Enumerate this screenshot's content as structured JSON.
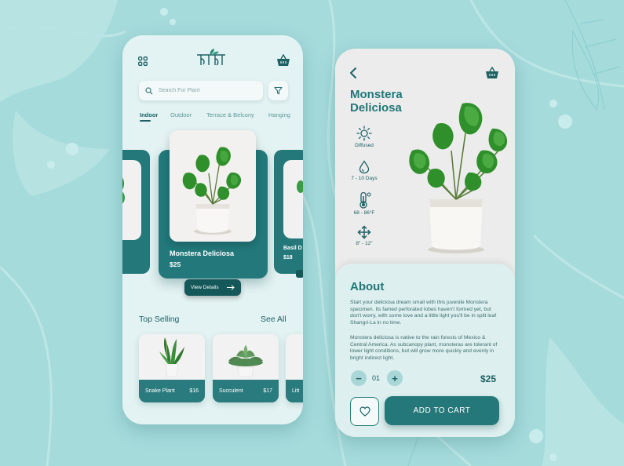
{
  "colors": {
    "background": "#a6dbdc",
    "accent": "#22777a",
    "dark_accent": "#14585a",
    "panel": "#e3f2f2"
  },
  "left_screen": {
    "menu_icon": "grid-icon",
    "logo_text": "ীটপা",
    "basket_icon": "basket-icon",
    "search": {
      "placeholder": "Search For Plant",
      "value": ""
    },
    "filter_icon": "filter-icon",
    "tabs": [
      {
        "label": "Indoor",
        "active": true
      },
      {
        "label": "Outdoor",
        "active": false
      },
      {
        "label": "Terrace & Belcony",
        "active": false
      },
      {
        "label": "Hanging",
        "active": false
      }
    ],
    "featured": {
      "name": "Monstera Deliciosa",
      "price": "$25",
      "button_label": "View Details",
      "button_icon": "arrow-right-icon"
    },
    "next_card": {
      "name": "Basil D",
      "price": "$18"
    },
    "top_selling": {
      "title": "Top Selling",
      "see_all": "See All",
      "items": [
        {
          "name": "Snake Plant",
          "price": "$16"
        },
        {
          "name": "Succulent",
          "price": "$17"
        },
        {
          "name": "Litt",
          "price": ""
        }
      ]
    }
  },
  "right_screen": {
    "back_icon": "chevron-left-icon",
    "basket_icon": "basket-icon",
    "title": "Monstera Deliciosa",
    "specs": [
      {
        "icon": "sun-icon",
        "label": "Diffused"
      },
      {
        "icon": "water-drop-icon",
        "label": "7 - 10 Days"
      },
      {
        "icon": "thermometer-icon",
        "label": "68 - 86°F"
      },
      {
        "icon": "size-arrows-icon",
        "label": "8\" - 12\""
      }
    ],
    "about": {
      "title": "About",
      "paragraph1": "Start your deliciosa dream small with this juvenile Monstera specimen. Its famed perforated lobes haven't formed yet, but don't worry, with some love and a little light you'll be in split leaf Shangri-La in no time.",
      "paragraph2": "Monstera deliciosa is native to the rain forests of Mexico & Central America. As subcanopy plant, monsteras are tolerant of lower light conditions, but will grow more quickly and evenly in bright indirect light."
    },
    "quantity": {
      "minus": "−",
      "value": "01",
      "plus": "+"
    },
    "price": "$25",
    "favorite_icon": "heart-icon",
    "cart_label": "ADD TO CART"
  }
}
